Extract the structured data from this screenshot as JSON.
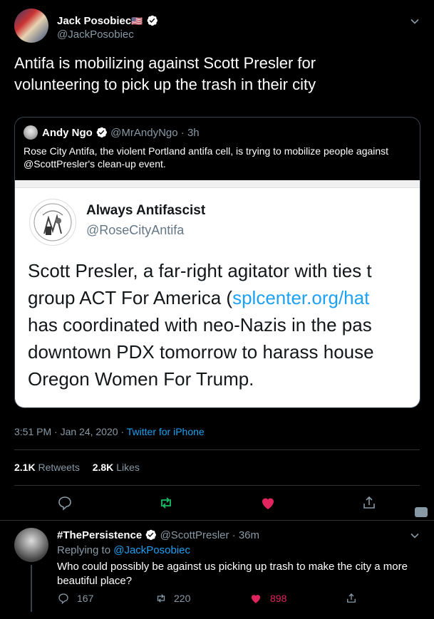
{
  "main_tweet": {
    "author_name": "Jack Posobiec",
    "flag": "🇺🇸",
    "handle": "@JackPosobiec",
    "text": "Antifa is mobilizing against Scott Presler for volunteering to pick up the trash in their city",
    "timestamp": "3:51 PM · Jan 24, 2020",
    "sep": "·",
    "client": "Twitter for iPhone",
    "retweets_count": "2.1K",
    "retweets_label": "Retweets",
    "likes_count": "2.8K",
    "likes_label": "Likes"
  },
  "quoted_tweet": {
    "author_name": "Andy Ngo",
    "handle": "@MrAndyNgo",
    "time": "· 3h",
    "text": "Rose City Antifa, the violent Portland antifa cell, is trying to mobilize people against @ScottPresler's clean-up event.",
    "screenshot": {
      "name": "Always Antifascist",
      "handle": "@RoseCityAntifa",
      "lines": [
        "Scott Presler, a far-right agitator with ties t",
        "group ACT For America (",
        "has coordinated with neo-Nazis in the pas",
        "downtown PDX tomorrow to harass house",
        "Oregon Women For Trump."
      ],
      "link_text": "splcenter.org/hat"
    }
  },
  "reply": {
    "author_name": "#ThePersistence",
    "handle": "@ScottPresler",
    "time": "· 36m",
    "replying_label": "Replying to",
    "replying_to": "@JackPosobiec",
    "text": "Who could possibly be against us picking up trash to make the city a more beautiful place?",
    "replies": "167",
    "retweets": "220",
    "likes": "898"
  },
  "colors": {
    "accent": "#1da1f2",
    "retweet": "#17bf63",
    "like": "#e0245e",
    "background": "#000000"
  }
}
